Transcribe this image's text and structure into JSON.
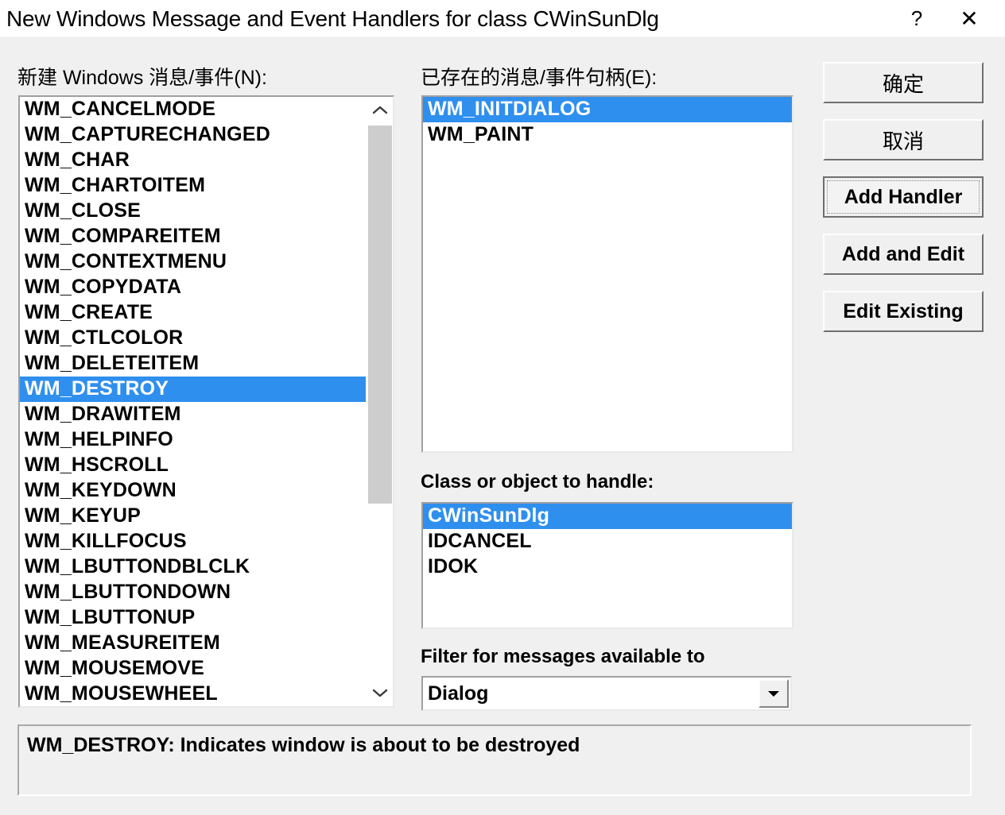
{
  "window": {
    "title": "New Windows Message and Event Handlers for class CWinSunDlg",
    "help_glyph": "?",
    "close_glyph": "✕"
  },
  "new_messages": {
    "label": "新建 Windows 消息/事件(N):",
    "selected": "WM_DESTROY",
    "items": [
      "WM_CANCELMODE",
      "WM_CAPTURECHANGED",
      "WM_CHAR",
      "WM_CHARTOITEM",
      "WM_CLOSE",
      "WM_COMPAREITEM",
      "WM_CONTEXTMENU",
      "WM_COPYDATA",
      "WM_CREATE",
      "WM_CTLCOLOR",
      "WM_DELETEITEM",
      "WM_DESTROY",
      "WM_DRAWITEM",
      "WM_HELPINFO",
      "WM_HSCROLL",
      "WM_KEYDOWN",
      "WM_KEYUP",
      "WM_KILLFOCUS",
      "WM_LBUTTONDBLCLK",
      "WM_LBUTTONDOWN",
      "WM_LBUTTONUP",
      "WM_MEASUREITEM",
      "WM_MOUSEMOVE",
      "WM_MOUSEWHEEL"
    ],
    "scrollbar": {
      "up_arrow": "chevron-up",
      "down_arrow": "chevron-down"
    }
  },
  "existing_handlers": {
    "label": "已存在的消息/事件句柄(E):",
    "selected": "WM_INITDIALOG",
    "items": [
      "WM_INITDIALOG",
      "WM_PAINT"
    ]
  },
  "class_or_object": {
    "label": "Class or object to handle:",
    "selected": "CWinSunDlg",
    "items": [
      "CWinSunDlg",
      "IDCANCEL",
      "IDOK"
    ]
  },
  "filter": {
    "label": "Filter for messages available to",
    "value": "Dialog",
    "arrow_glyph": "▼"
  },
  "buttons": {
    "ok": "确定",
    "cancel": "取消",
    "add_handler": "Add Handler",
    "add_and_edit": "Add and Edit",
    "edit_existing": "Edit Existing"
  },
  "description": {
    "text": "WM_DESTROY:  Indicates window is about to be destroyed"
  },
  "colors": {
    "selection": "#2f8fee",
    "selection_text": "#ffffff",
    "dialog_bg": "#f0f0f0",
    "titlebar_bg": "#ffffff",
    "listbox_bg": "#ffffff",
    "scroll_thumb": "#cdcdcd"
  }
}
